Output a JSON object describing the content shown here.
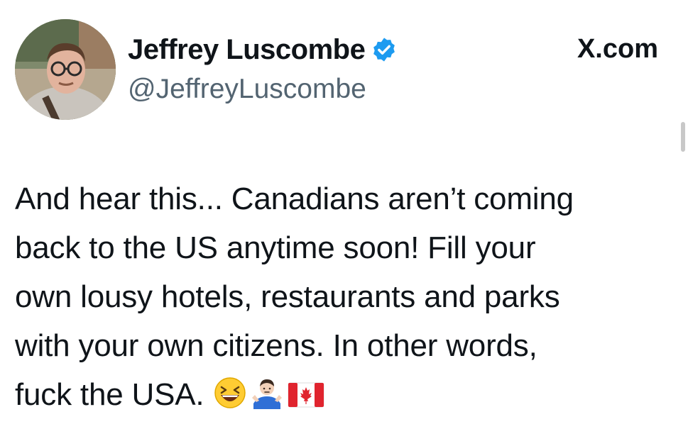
{
  "author": {
    "display_name": "Jeffrey Luscombe",
    "handle": "@JeffreyLuscombe",
    "verified_icon": "verified-badge-icon",
    "avatar_icon": "avatar"
  },
  "header": {
    "site_label": "X.com"
  },
  "tweet": {
    "lines": [
      "And hear this... Canadians aren’t coming",
      "back to the US anytime soon! Fill your",
      "own lousy hotels, restaurants and parks",
      "with your own citizens. In other words,",
      "fuck the USA."
    ],
    "emojis": [
      "laughing-face-emoji",
      "person-shrugging-emoji",
      "canada-flag-emoji"
    ]
  },
  "colors": {
    "text": "#0f1419",
    "secondary_text": "#536471",
    "verified_blue": "#1d9bf0",
    "canada_red": "#e0242e"
  }
}
